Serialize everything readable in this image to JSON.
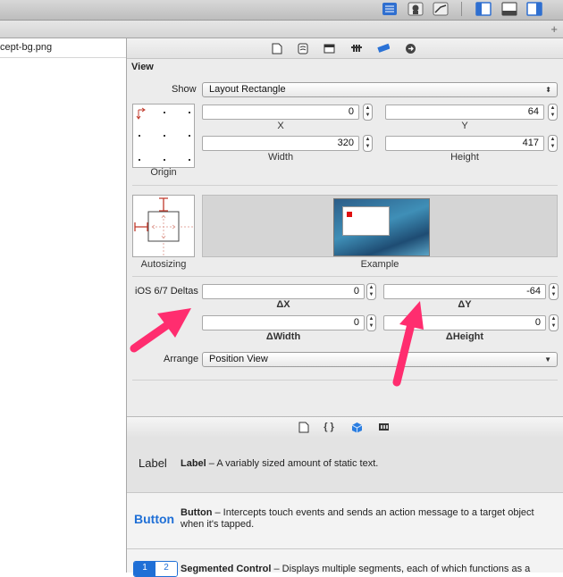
{
  "file": {
    "name": "cept-bg.png"
  },
  "inspector": {
    "section_title": "View",
    "show": {
      "label": "Show",
      "value": "Layout Rectangle"
    },
    "x": {
      "value": "0",
      "label": "X"
    },
    "y": {
      "value": "64",
      "label": "Y"
    },
    "width": {
      "value": "320",
      "label": "Width"
    },
    "height": {
      "value": "417",
      "label": "Height"
    },
    "origin_label": "Origin",
    "autosizing_label": "Autosizing",
    "example_label": "Example",
    "deltas": {
      "label": "iOS 6/7 Deltas",
      "dx": {
        "value": "0",
        "label": "ΔX"
      },
      "dy": {
        "value": "-64",
        "label": "ΔY"
      },
      "dwidth": {
        "value": "0",
        "label": "ΔWidth"
      },
      "dheight": {
        "value": "0",
        "label": "ΔHeight"
      }
    },
    "arrange": {
      "label": "Arrange",
      "value": "Position View"
    }
  },
  "library": {
    "items": [
      {
        "icon_text": "Label",
        "title": "Label",
        "description": " – A variably sized amount of static text."
      },
      {
        "icon_text": "Button",
        "title": "Button",
        "description": " – Intercepts touch events and sends an action message to a target object when it's tapped."
      },
      {
        "icon_text": "",
        "title": "Segmented Control",
        "description": " – Displays multiple segments, each of which functions as a"
      }
    ]
  },
  "colors": {
    "accent": "#1f6fd6",
    "annotation_arrow": "#ff2d6f"
  }
}
